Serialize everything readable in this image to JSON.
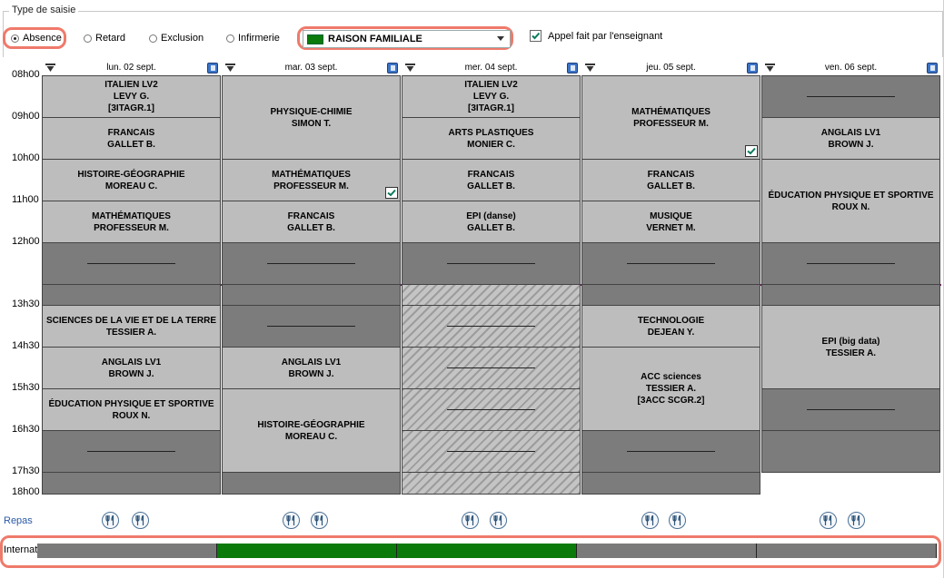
{
  "type_saisie": {
    "legend": "Type de saisie",
    "radios": [
      {
        "label": "Absence",
        "selected": true
      },
      {
        "label": "Retard",
        "selected": false
      },
      {
        "label": "Exclusion",
        "selected": false
      },
      {
        "label": "Infirmerie",
        "selected": false
      }
    ],
    "motif": {
      "value": "RAISON FAMILIALE",
      "color": "#0a7a0a"
    },
    "appel": {
      "label": "Appel fait par l'enseignant",
      "checked": true
    }
  },
  "hours": [
    "08h00",
    "09h00",
    "10h00",
    "11h00",
    "12h00",
    "13h30",
    "14h30",
    "15h30",
    "16h30",
    "17h30",
    "18h00"
  ],
  "days": [
    {
      "label": "lun. 02 sept.",
      "cells": [
        {
          "lines": [
            "ITALIEN LV2",
            "LEVY G.",
            "[3ITAGR.1]"
          ]
        },
        {
          "lines": [
            "FRANCAIS",
            "GALLET B."
          ]
        },
        {
          "lines": [
            "HISTOIRE-GÉOGRAPHIE",
            "MOREAU C."
          ]
        },
        {
          "lines": [
            "MATHÉMATIQUES",
            "PROFESSEUR M."
          ]
        },
        {
          "kind": "empty"
        },
        {
          "kind": "empty-small"
        },
        {
          "lines": [
            "SCIENCES DE LA VIE ET DE LA TERRE",
            "TESSIER A."
          ]
        },
        {
          "lines": [
            "ANGLAIS LV1",
            "BROWN J."
          ]
        },
        {
          "lines": [
            "ÉDUCATION PHYSIQUE ET SPORTIVE",
            "ROUX N."
          ]
        },
        {
          "kind": "empty"
        },
        {
          "kind": "empty-small"
        }
      ]
    },
    {
      "label": "mar. 03 sept.",
      "cells": [
        {
          "lines": [
            "PHYSIQUE-CHIMIE",
            "SIMON T."
          ]
        },
        {
          "lines": [
            "MATHÉMATIQUES",
            "PROFESSEUR M."
          ],
          "checked": true
        },
        {
          "lines": [
            "FRANCAIS",
            "GALLET B."
          ]
        },
        {
          "kind": "empty"
        },
        {
          "kind": "empty-small"
        },
        {
          "kind": "empty"
        },
        {
          "lines": [
            "ANGLAIS LV1",
            "BROWN J."
          ]
        },
        {
          "lines": [
            "HISTOIRE-GÉOGRAPHIE",
            "MOREAU C."
          ]
        },
        {
          "kind": "empty-small"
        }
      ]
    },
    {
      "label": "mer. 04 sept.",
      "cells": [
        {
          "lines": [
            "ITALIEN LV2",
            "LEVY G.",
            "[3ITAGR.1]"
          ]
        },
        {
          "lines": [
            "ARTS PLASTIQUES",
            "MONIER C."
          ]
        },
        {
          "lines": [
            "FRANCAIS",
            "GALLET B."
          ]
        },
        {
          "lines": [
            "EPI (danse)",
            "GALLET B."
          ]
        },
        {
          "kind": "empty"
        },
        {
          "kind": "hatch-top"
        },
        {
          "kind": "hatch"
        },
        {
          "kind": "hatch"
        },
        {
          "kind": "hatch"
        },
        {
          "kind": "hatch"
        },
        {
          "kind": "hatch-end"
        }
      ]
    },
    {
      "label": "jeu. 05 sept.",
      "cells": [
        {
          "lines": [
            "MATHÉMATIQUES",
            "PROFESSEUR M."
          ],
          "checked": true
        },
        {
          "lines": [
            "FRANCAIS",
            "GALLET B."
          ]
        },
        {
          "lines": [
            "MUSIQUE",
            "VERNET M."
          ]
        },
        {
          "kind": "empty"
        },
        {
          "kind": "empty-small"
        },
        {
          "lines": [
            "TECHNOLOGIE",
            "DEJEAN Y."
          ]
        },
        {
          "lines": [
            "ACC sciences",
            "TESSIER A.",
            "[3ACC SCGR.2]"
          ]
        },
        {
          "kind": "empty"
        },
        {
          "kind": "empty-small"
        }
      ]
    },
    {
      "label": "ven. 06 sept.",
      "cells": [
        {
          "kind": "empty"
        },
        {
          "lines": [
            "ANGLAIS LV1",
            "BROWN J."
          ]
        },
        {
          "lines": [
            "ÉDUCATION PHYSIQUE ET SPORTIVE",
            "ROUX N."
          ]
        },
        {
          "kind": "empty"
        },
        {
          "kind": "empty-small"
        },
        {
          "lines": [
            "EPI (big data)",
            "TESSIER A."
          ]
        },
        {
          "kind": "empty"
        },
        {
          "kind": "empty-small"
        }
      ]
    }
  ],
  "repas": {
    "label": "Repas"
  },
  "internat": {
    "label": "Internat",
    "nights": [
      {
        "status": "normal",
        "color": "#7a7a7a"
      },
      {
        "status": "absent",
        "color": "#0a7a0a"
      },
      {
        "status": "absent",
        "color": "#0a7a0a"
      },
      {
        "status": "normal",
        "color": "#7a7a7a"
      },
      {
        "status": "normal",
        "color": "#7a7a7a"
      }
    ]
  }
}
